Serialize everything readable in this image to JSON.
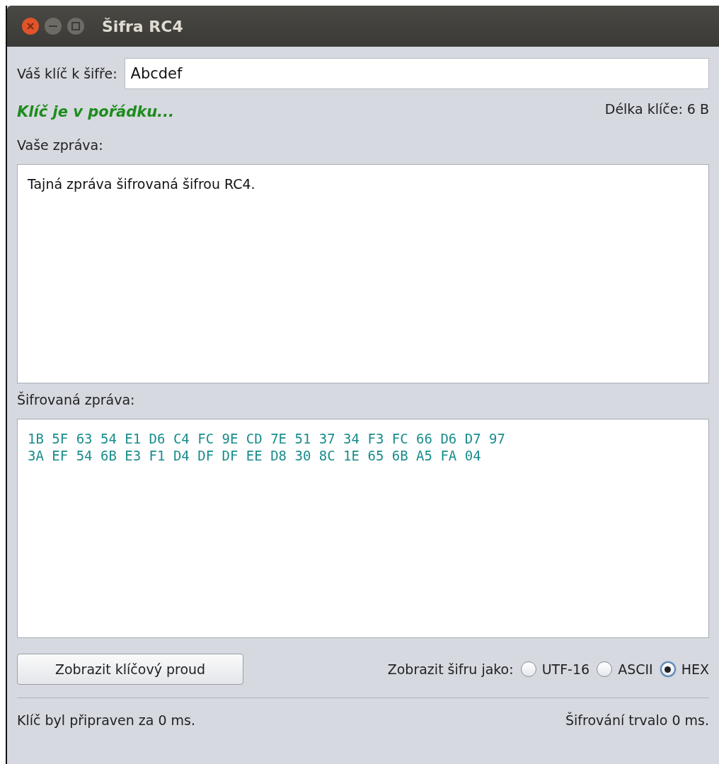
{
  "window": {
    "title": "Šifra RC4"
  },
  "key": {
    "label": "Váš klíč k šifře:",
    "value": "Abcdef"
  },
  "key_status": {
    "text": "Klíč je v pořádku...",
    "valid": true
  },
  "key_length": "Délka klíče: 6 B",
  "message": {
    "label": "Vaše zpráva:",
    "value": "Tajná zpráva šifrovaná šifrou RC4."
  },
  "cipher": {
    "label": "Šifrovaná zpráva:",
    "lines": [
      "1B 5F 63 54 E1 D6 C4 FC 9E CD 7E 51 37 34 F3 FC 66 D6 D7 97",
      "3A EF 54 6B E3 F1 D4 DF DF EE D8 30 8C 1E 65 6B A5 FA 04"
    ]
  },
  "keystream_button": "Zobrazit klíčový proud",
  "display_as": {
    "label": "Zobrazit šifru jako:",
    "options": [
      {
        "label": "UTF-16",
        "selected": false
      },
      {
        "label": "ASCII",
        "selected": false
      },
      {
        "label": "HEX",
        "selected": true
      }
    ]
  },
  "status_bar": {
    "left": "Klíč byl připraven za 0 ms.",
    "right": "Šifrování trvalo 0 ms."
  }
}
